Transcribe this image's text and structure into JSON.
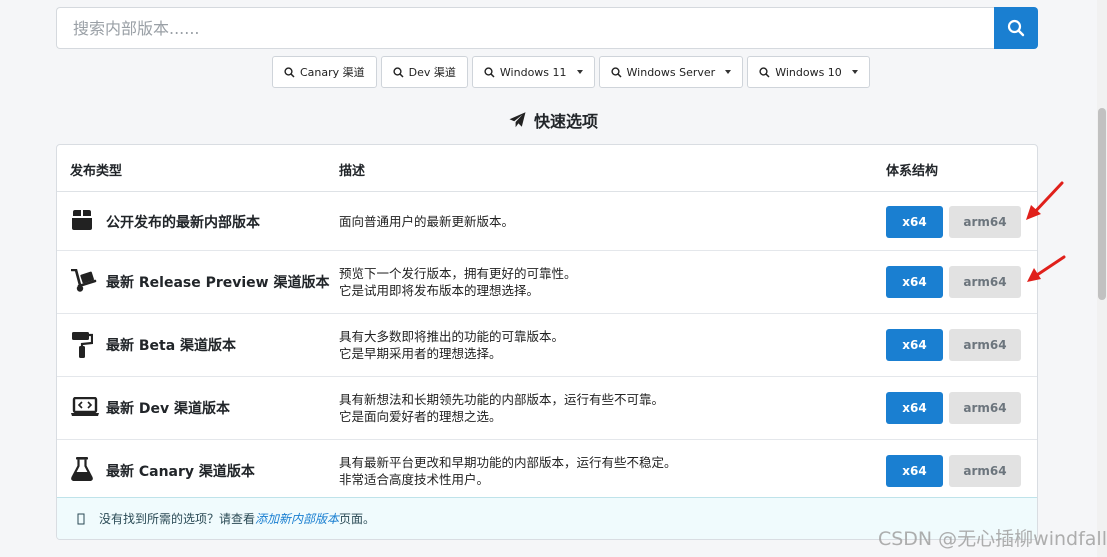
{
  "search": {
    "placeholder": "搜索内部版本......"
  },
  "filters": [
    {
      "label": "Canary 渠道",
      "dropdown": false
    },
    {
      "label": "Dev 渠道",
      "dropdown": false
    },
    {
      "label": "Windows 11",
      "dropdown": true
    },
    {
      "label": "Windows Server",
      "dropdown": true
    },
    {
      "label": "Windows 10",
      "dropdown": true
    }
  ],
  "quick_options": {
    "title": "快速选项",
    "icon": "paper-plane-icon"
  },
  "table": {
    "headers": {
      "type": "发布类型",
      "desc": "描述",
      "arch": "体系结构"
    },
    "rows": [
      {
        "icon": "box-icon",
        "name": "公开发布的最新内部版本",
        "desc1": "面向普通用户的最新更新版本。",
        "desc2": "",
        "x64": "x64",
        "arm64": "arm64"
      },
      {
        "icon": "dolly-icon",
        "name": "最新 Release Preview 渠道版本",
        "desc1": "预览下一个发行版本，拥有更好的可靠性。",
        "desc2": "它是试用即将发布版本的理想选择。",
        "x64": "x64",
        "arm64": "arm64"
      },
      {
        "icon": "paint-roller-icon",
        "name": "最新 Beta 渠道版本",
        "desc1": "具有大多数即将推出的功能的可靠版本。",
        "desc2": "它是早期采用者的理想选择。",
        "x64": "x64",
        "arm64": "arm64"
      },
      {
        "icon": "laptop-code-icon",
        "name": "最新 Dev 渠道版本",
        "desc1": "具有新想法和长期领先功能的内部版本，运行有些不可靠。",
        "desc2": "它是面向爱好者的理想之选。",
        "x64": "x64",
        "arm64": "arm64"
      },
      {
        "icon": "flask-icon",
        "name": "最新 Canary 渠道版本",
        "desc1": "具有最新平台更改和早期功能的内部版本，运行有些不稳定。",
        "desc2": "非常适合高度技术性用户。",
        "x64": "x64",
        "arm64": "arm64"
      }
    ]
  },
  "notice": {
    "prefix": "没有找到所需的选项？请查看",
    "link": "添加新内部版本",
    "suffix": "页面。"
  },
  "watermark": "CSDN @无心插柳windfall",
  "colors": {
    "accent": "#1a7fd1",
    "arm_button": "#e2e2e2",
    "annotation_arrow": "#e0201b"
  }
}
